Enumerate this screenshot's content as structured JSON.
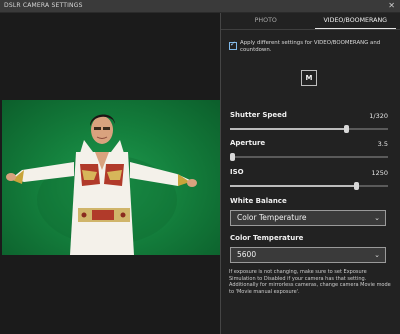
{
  "window": {
    "title": "DSLR CAMERA SETTINGS",
    "close_glyph": "✕"
  },
  "tabs": [
    {
      "label": "PHOTO",
      "active": false
    },
    {
      "label": "VIDEO/BOOMERANG",
      "active": true
    }
  ],
  "apply_checkbox": {
    "checked": true,
    "label": "Apply different settings for VIDEO/BOOMERANG and countdown."
  },
  "mode_button": {
    "label": "M"
  },
  "shutter_speed": {
    "label": "Shutter Speed",
    "value": "1/320",
    "level": 0.74
  },
  "aperture": {
    "label": "Aperture",
    "value": "3.5",
    "level": 0.0
  },
  "iso": {
    "label": "ISO",
    "value": "1250",
    "level": 0.8
  },
  "white_balance": {
    "label": "White Balance",
    "selected": "Color Temperature"
  },
  "color_temperature": {
    "label": "Color Temperature",
    "selected": "5600"
  },
  "note": "If exposure is not changing, make sure to set Exposure Simulation to Disabled if your camera has that setting. Additionally for mirrorless cameras, change camera Movie mode to 'Movie manual exposure'.",
  "icons": {
    "checkbox": "check-icon",
    "dropdown": "chevron-down-icon",
    "close": "close-icon"
  },
  "colors": {
    "accent": "#7fb8e8",
    "backdrop": "#14803d",
    "background": "#222222"
  }
}
